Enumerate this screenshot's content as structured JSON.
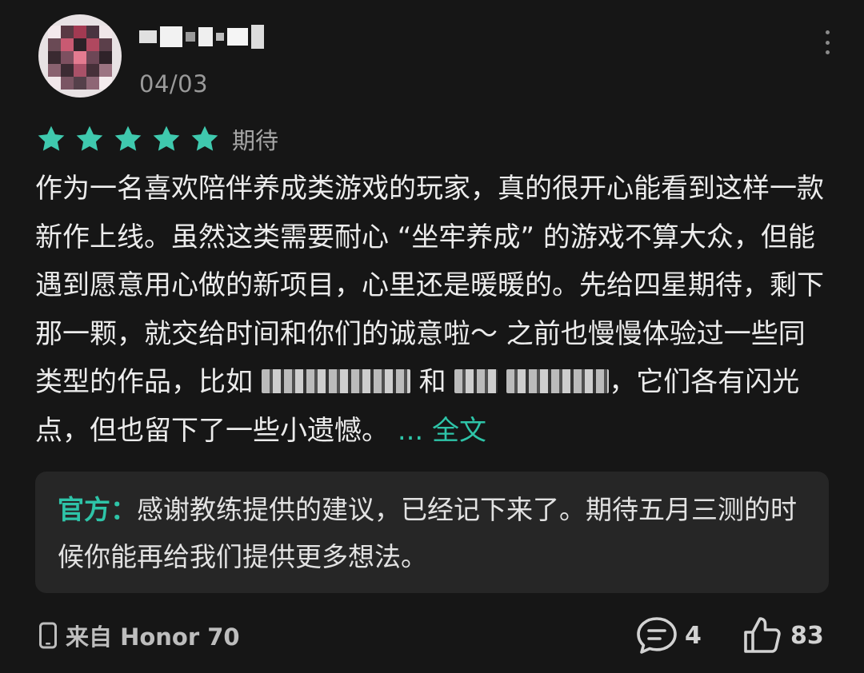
{
  "header": {
    "date": "04/03"
  },
  "rating": {
    "stars": 5,
    "max": 5,
    "label": "期待",
    "star_color": "#3fc9ae"
  },
  "review": {
    "text_1": "作为一名喜欢陪伴养成类游戏的玩家，真的很开心能看到这样一款新作上线。虽然这类需要耐心 “坐牢养成” 的游戏不算大众，但能遇到愿意用心做的新项目，心里还是暖暖的。先给四星期待，剩下那一颗，就交给时间和你们的诚意啦～ 之前也慢慢体验过一些同类型的作品，比如 ",
    "text_2": " 和 ",
    "text_3": "，它们各有闪光点，但也留下了一些小遗憾。 ",
    "expand_label": "... 全文"
  },
  "official_reply": {
    "label": "官方：",
    "text": "感谢教练提供的建议，已经记下来了。期待五月三测的时候你能再给我们提供更多想法。"
  },
  "footer": {
    "device": "来自 Honor 70",
    "comment_count": "4",
    "like_count": "83"
  },
  "icons": [
    "more-vertical-icon",
    "star-icon",
    "phone-icon",
    "comment-icon",
    "thumbs-up-icon"
  ],
  "colors": {
    "accent": "#2ec4a8",
    "background": "#161616",
    "card": "#262626"
  }
}
